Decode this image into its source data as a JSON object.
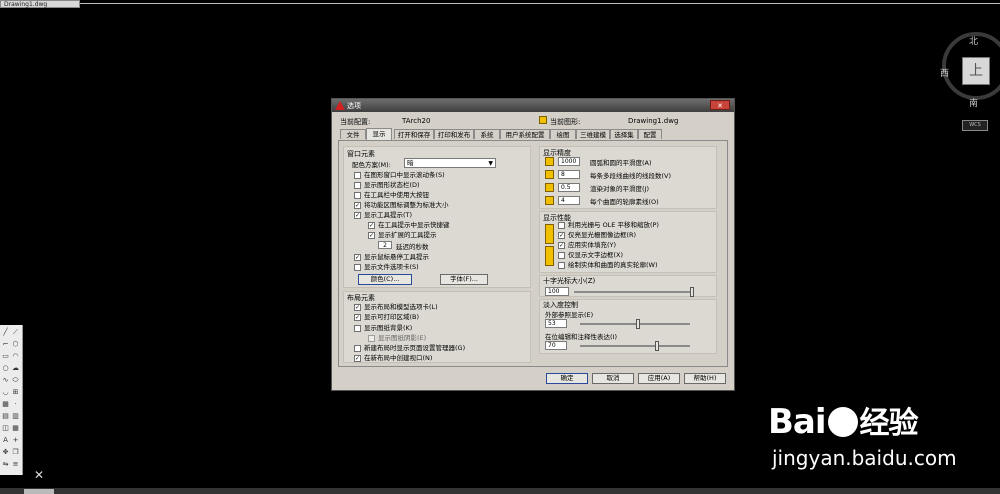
{
  "window": {
    "doc_tab": "Drawing1.dwg"
  },
  "viewcube": {
    "north": "北",
    "west": "西",
    "south": "南",
    "top_face": "上",
    "wcs": "WCS"
  },
  "dialog": {
    "title": "选项",
    "close": "✕",
    "current_profile_label": "当前配置:",
    "current_profile_value": "TArch20",
    "current_drawing_label": "当前图形:",
    "current_drawing_value": "Drawing1.dwg",
    "tabs": [
      "文件",
      "显示",
      "打开和保存",
      "打印和发布",
      "系统",
      "用户系统配置",
      "绘图",
      "三维建模",
      "选择集",
      "配置"
    ],
    "active_tab": "显示",
    "window_elements": {
      "title": "窗口元素",
      "color_scheme_label": "配色方案(M):",
      "color_scheme_value": "暗",
      "items": [
        {
          "label": "在图形窗口中显示滚动条(S)",
          "checked": false
        },
        {
          "label": "显示图形状态栏(D)",
          "checked": false
        },
        {
          "label": "在工具栏中使用大按钮",
          "checked": false
        },
        {
          "label": "将功能区图标调整为标准大小",
          "checked": true
        },
        {
          "label": "显示工具提示(T)",
          "checked": true
        },
        {
          "label": "在工具提示中显示快捷键",
          "checked": true
        },
        {
          "label": "显示扩展的工具提示",
          "checked": true
        },
        {
          "label": "显示鼠标悬停工具提示",
          "checked": true
        },
        {
          "label": "显示文件选项卡(S)",
          "checked": false
        }
      ],
      "delay_value": "2",
      "delay_label": "延迟的秒数",
      "colors_button": "颜色(C)...",
      "fonts_button": "字体(F)..."
    },
    "layout_elements": {
      "title": "布局元素",
      "items": [
        {
          "label": "显示布局和模型选项卡(L)",
          "checked": true
        },
        {
          "label": "显示可打印区域(B)",
          "checked": true
        },
        {
          "label": "显示图纸背景(K)",
          "checked": false
        },
        {
          "label": "显示图纸阴影(E)",
          "checked": false
        },
        {
          "label": "新建布局时显示页面设置管理器(G)",
          "checked": false
        },
        {
          "label": "在新布局中创建视口(N)",
          "checked": true
        }
      ]
    },
    "display_resolution": {
      "title": "显示精度",
      "items": [
        {
          "value": "1000",
          "label": "圆弧和圆的平滑度(A)"
        },
        {
          "value": "8",
          "label": "每条多段线曲线的线段数(V)"
        },
        {
          "value": "0.5",
          "label": "渲染对象的平滑度(J)"
        },
        {
          "value": "4",
          "label": "每个曲面的轮廓素线(O)"
        }
      ]
    },
    "display_performance": {
      "title": "显示性能",
      "items": [
        {
          "label": "利用光栅与 OLE 平移和缩放(P)",
          "checked": false
        },
        {
          "label": "仅亮显光栅图像边框(R)",
          "checked": true
        },
        {
          "label": "应用实体填充(Y)",
          "checked": true
        },
        {
          "label": "仅显示文字边框(X)",
          "checked": false
        },
        {
          "label": "绘制实体和曲面的真实轮廓(W)",
          "checked": false
        }
      ]
    },
    "crosshair": {
      "title": "十字光标大小(Z)",
      "value": "100",
      "fraction": 1.0
    },
    "fade_control": {
      "title": "淡入度控制",
      "xref_label": "外部参照显示(E)",
      "xref_value": "53",
      "xref_fraction": 0.53,
      "inplace_label": "在位编辑和注释性表达(I)",
      "inplace_value": "70",
      "inplace_fraction": 0.7
    },
    "buttons": {
      "ok": "确定",
      "cancel": "取消",
      "apply": "应用(A)",
      "help": "帮助(H)"
    }
  },
  "watermark": {
    "brand": "Bai",
    "brand_cn": "经验",
    "url": "jingyan.baidu.com"
  }
}
